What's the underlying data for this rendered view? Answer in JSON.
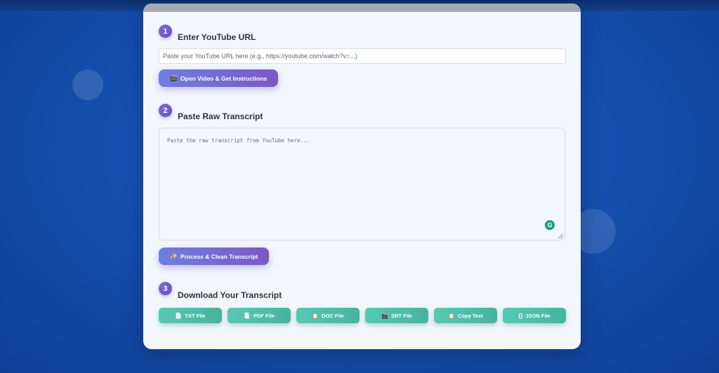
{
  "steps": [
    {
      "number": "1",
      "title": "Enter YouTube URL"
    },
    {
      "number": "2",
      "title": "Paste Raw Transcript"
    },
    {
      "number": "3",
      "title": "Download Your Transcript"
    }
  ],
  "url_input": {
    "value": "",
    "placeholder": "Paste your YouTube URL here (e.g., https://youtube.com/watch?v=...)"
  },
  "open_video_button": {
    "icon": "🎬",
    "label": "Open Video & Get Instructions"
  },
  "transcript_input": {
    "value": "",
    "placeholder": "Paste the raw transcript from YouTube here..."
  },
  "grammarly_badge": "G",
  "process_button": {
    "icon": "✨",
    "label": "Process & Clean Transcript"
  },
  "downloads": [
    {
      "icon": "📄",
      "label": "TXT File"
    },
    {
      "icon": "📑",
      "label": "PDF File"
    },
    {
      "icon": "📋",
      "label": "DOC File"
    },
    {
      "icon": "🎬",
      "label": "SRT File"
    },
    {
      "icon": "📋",
      "label": "Copy Text"
    },
    {
      "icon": "{}",
      "label": "JSON File"
    }
  ],
  "colors": {
    "background": "#1550b0",
    "card": "#f3f7fc",
    "primary_gradient_start": "#6f7fe0",
    "primary_gradient_end": "#7b58c6",
    "download_button": "#4fbfa9",
    "step_badge": "#7b6bd6"
  }
}
